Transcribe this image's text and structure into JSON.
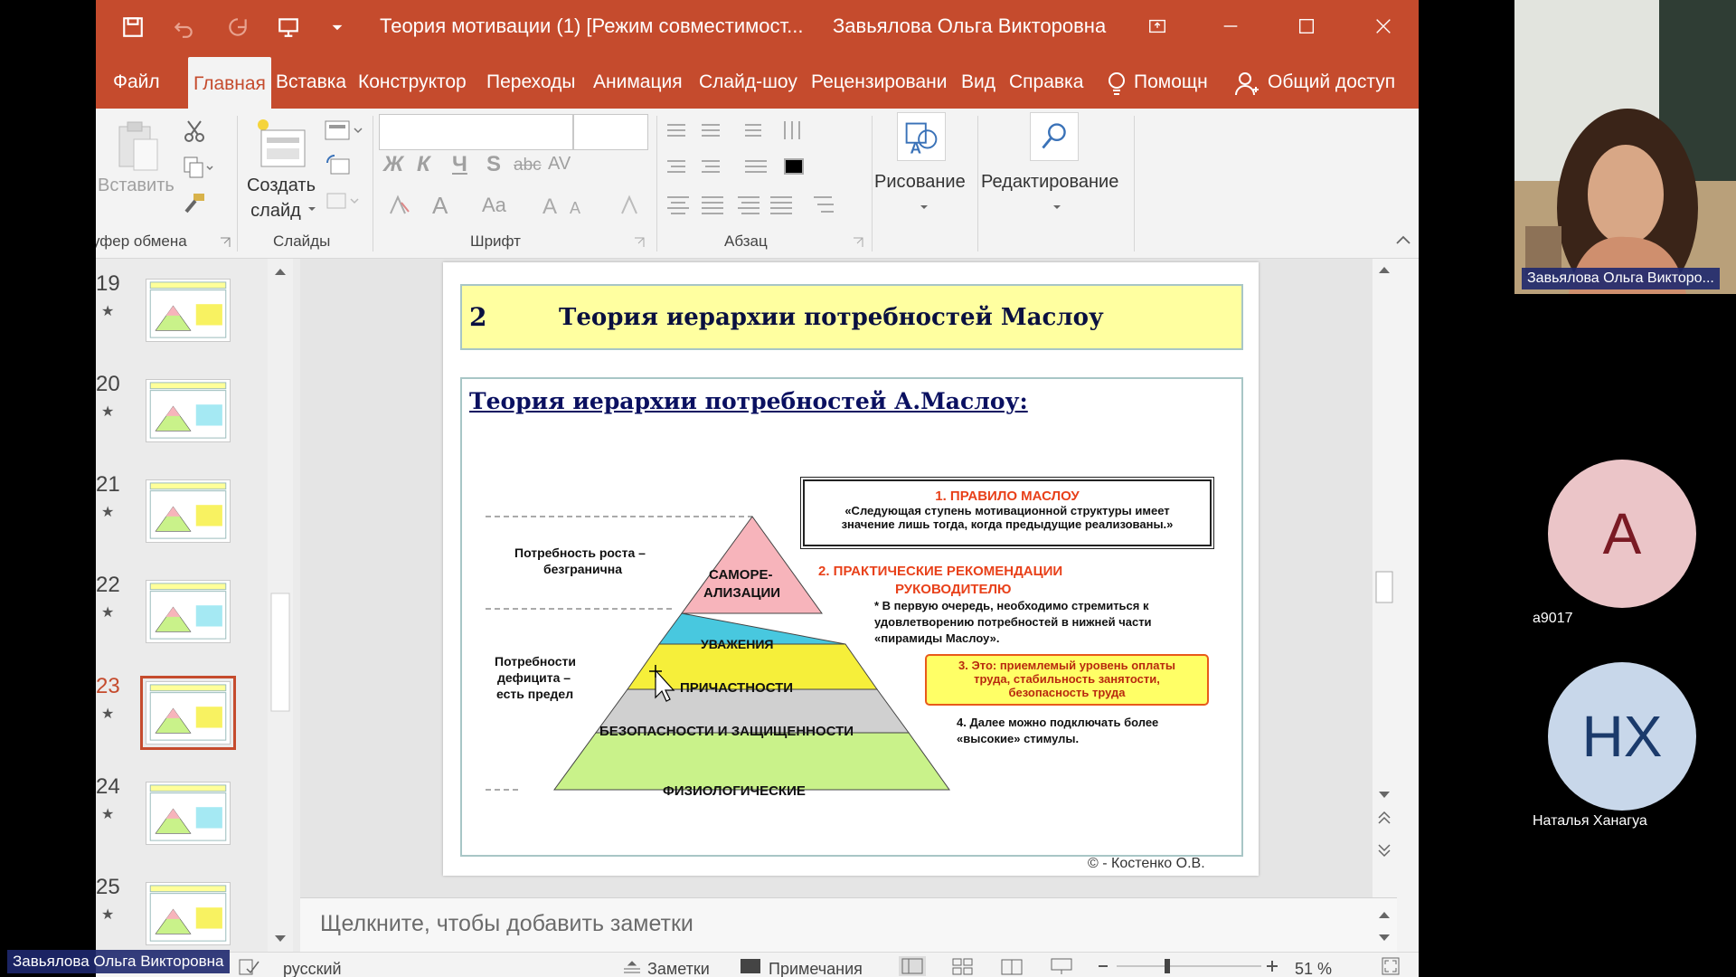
{
  "window": {
    "doc_title": "Теория мотивации (1) [Режим совместимост...",
    "user_name": "Завьялова Ольга Викторовна"
  },
  "tabs": [
    "Файл",
    "Главная",
    "Вставка",
    "Конструктор",
    "Переходы",
    "Анимация",
    "Слайд-шоу",
    "Рецензировани",
    "Вид",
    "Справка",
    "Помощн",
    "Общий доступ"
  ],
  "active_tab": "Главная",
  "ribbon": {
    "clipboard": {
      "paste": "Вставить",
      "label": "уфер обмена"
    },
    "slides": {
      "new_slide_1": "Создать",
      "new_slide_2": "слайд",
      "label": "Слайды"
    },
    "font": {
      "label": "Шрифт",
      "bold": "Ж",
      "italic": "К",
      "underline": "Ч",
      "shadow": "S",
      "strike": "abc",
      "spacing": "AV",
      "color": "A",
      "case": "Aa"
    },
    "paragraph": {
      "label": "Абзац"
    },
    "drawing": {
      "label": "Рисование"
    },
    "editing": {
      "label": "Редактирование"
    }
  },
  "thumbnails": [
    {
      "num": "19"
    },
    {
      "num": "20"
    },
    {
      "num": "21"
    },
    {
      "num": "22"
    },
    {
      "num": "23",
      "current": true
    },
    {
      "num": "24"
    },
    {
      "num": "25"
    }
  ],
  "slide": {
    "number": "2",
    "title": "Теория иерархии потребностей Маслоу",
    "body_title": "Теория иерархии потребностей А.Маслоу:",
    "growth_1": "Потребность роста –",
    "growth_2": "безгранична",
    "deficit_1": "Потребности",
    "deficit_2": "дефицита –",
    "deficit_3": "есть предел",
    "levels": {
      "self_1": "САМОРЕ-",
      "self_2": "АЛИЗАЦИИ",
      "respect": "УВАЖЕНИЯ",
      "belonging": "ПРИЧАСТНОСТИ",
      "safety": "БЕЗОПАСНОСТИ И ЗАЩИЩЕННОСТИ",
      "physio": "ФИЗИОЛОГИЧЕСКИЕ"
    },
    "rule1_title": "1. ПРАВИЛО МАСЛОУ",
    "rule1_text_1": "«Следующая ступень мотивационной структуры имеет",
    "rule1_text_2": "значение лишь тогда, когда предыдущие реализованы.»",
    "rule2_title_1": "2. ПРАКТИЧЕСКИЕ РЕКОМЕНДАЦИИ",
    "rule2_title_2": "РУКОВОДИТЕЛЮ",
    "rule2_text_1": "* В первую очередь, необходимо стремиться к",
    "rule2_text_2": "удовлетворению потребностей в нижней части",
    "rule2_text_3": "«пирамиды Маслоу».",
    "rule3_1": "3. Это: приемлемый уровень оплаты",
    "rule3_2": "труда, стабильность занятости,",
    "rule3_3": "безопасность труда",
    "rule4_1": "4. Далее можно подключать более",
    "rule4_2": "«высокие» стимулы.",
    "copyright": "© - Костенко О.В."
  },
  "notes_placeholder": "Щелкните, чтобы добавить заметки",
  "status": {
    "language": "русский",
    "notes": "Заметки",
    "comments": "Примечания",
    "zoom": "51 %"
  },
  "participants": {
    "presenter_tag": "Завьялова Ольга Викторо...",
    "self_tag": "Завьялова Ольга Викторовна",
    "p1": {
      "initials": "А",
      "name": "a9017"
    },
    "p2": {
      "initials": "НХ",
      "name": "Наталья Ханагуа"
    }
  },
  "colors": {
    "accent": "#c54b2d",
    "avatar_pink": "#ebc5c8",
    "avatar_blue": "#c8d7ea"
  }
}
